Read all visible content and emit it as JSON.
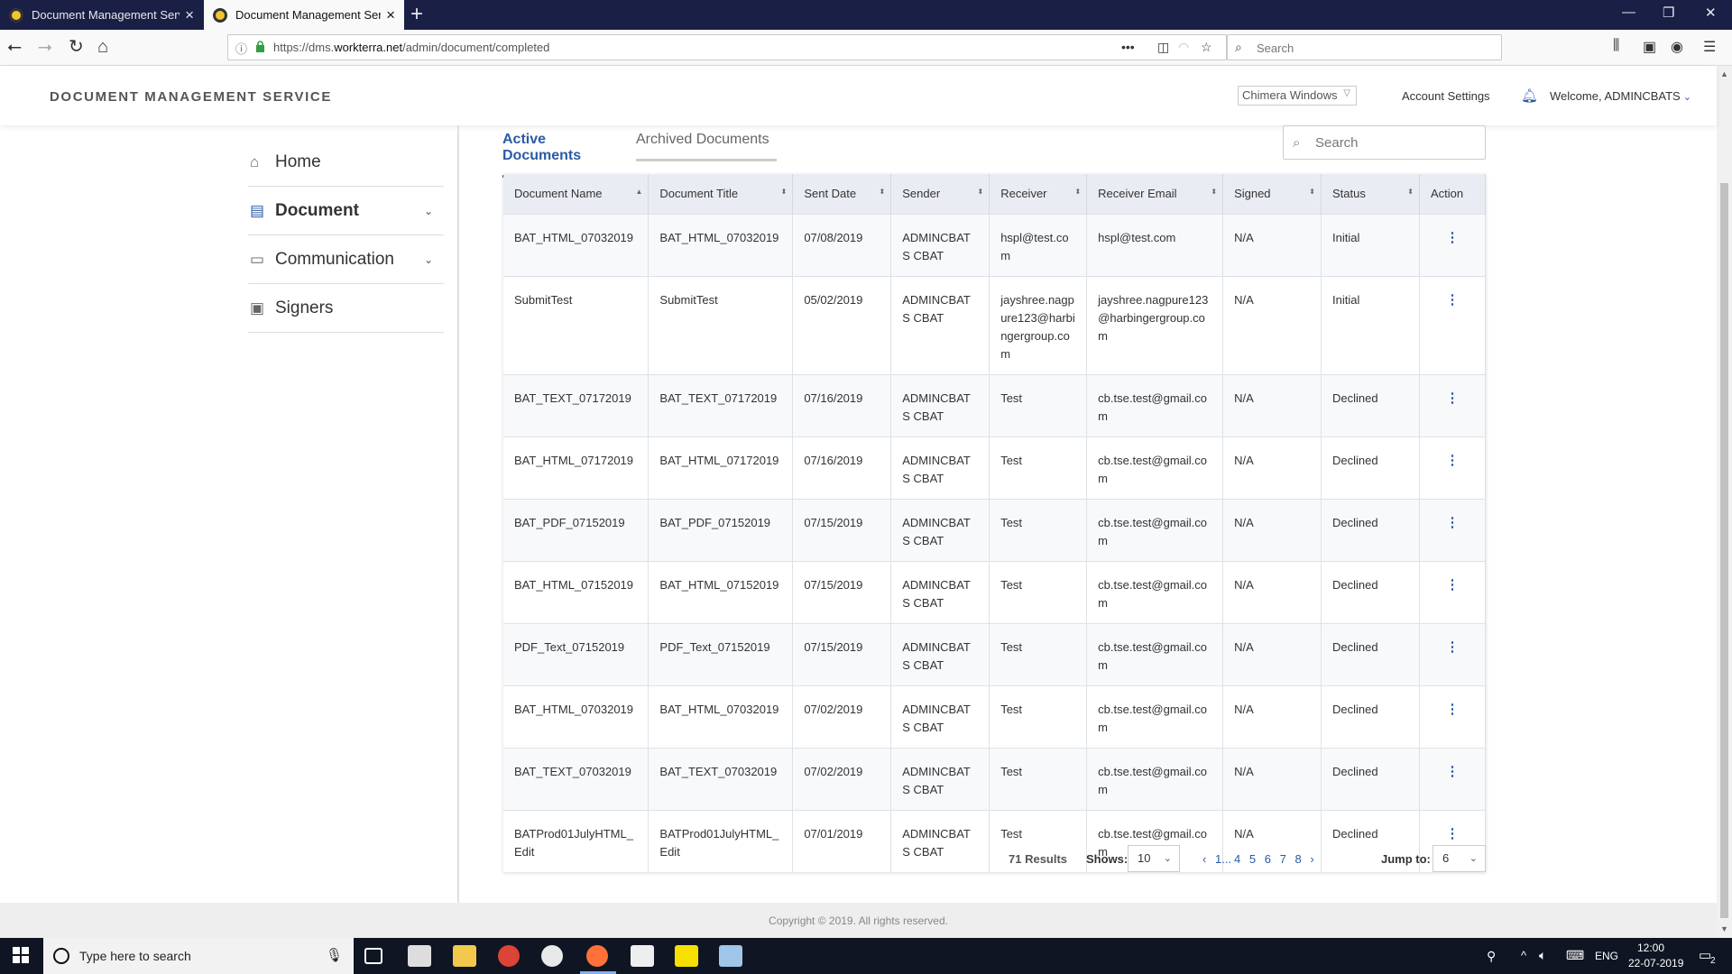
{
  "browser": {
    "tabs": [
      {
        "title": "Document Management Servic"
      },
      {
        "title": "Document Management Servic"
      }
    ],
    "url_prefix": "https://dms.",
    "url_domain": "workterra.net",
    "url_path": "/admin/document/completed",
    "search_placeholder": "Search"
  },
  "header": {
    "app_title": "DOCUMENT MANAGEMENT SERVICE",
    "company": "Chimera Windows",
    "account_settings": "Account Settings",
    "welcome": "Welcome, ADMINCBATS"
  },
  "sidebar": {
    "items": [
      {
        "label": "Home",
        "icon": "home-icon"
      },
      {
        "label": "Document",
        "icon": "document-icon"
      },
      {
        "label": "Communication",
        "icon": "chat-icon"
      },
      {
        "label": "Signers",
        "icon": "badge-icon"
      }
    ]
  },
  "tabs": {
    "active": "Active Documents",
    "archived": "Archived Documents"
  },
  "search": {
    "placeholder": "Search"
  },
  "table": {
    "columns": [
      "Document Name",
      "Document Title",
      "Sent Date",
      "Sender",
      "Receiver",
      "Receiver Email",
      "Signed",
      "Status",
      "Action"
    ],
    "rows": [
      [
        "BAT_HTML_07032019",
        "BAT_HTML_07032019",
        "07/08/2019",
        "ADMINCBATS CBAT",
        "hspl@test.com",
        "hspl@test.com",
        "N/A",
        "Initial"
      ],
      [
        "SubmitTest",
        "SubmitTest",
        "05/02/2019",
        "ADMINCBATS CBAT",
        "jayshree.nagpure123@harbingergroup.com",
        "jayshree.nagpure123@harbingergroup.com",
        "N/A",
        "Initial"
      ],
      [
        "BAT_TEXT_07172019",
        "BAT_TEXT_07172019",
        "07/16/2019",
        "ADMINCBATS CBAT",
        "Test",
        "cb.tse.test@gmail.com",
        "N/A",
        "Declined"
      ],
      [
        "BAT_HTML_07172019",
        "BAT_HTML_07172019",
        "07/16/2019",
        "ADMINCBATS CBAT",
        "Test",
        "cb.tse.test@gmail.com",
        "N/A",
        "Declined"
      ],
      [
        "BAT_PDF_07152019",
        "BAT_PDF_07152019",
        "07/15/2019",
        "ADMINCBATS CBAT",
        "Test",
        "cb.tse.test@gmail.com",
        "N/A",
        "Declined"
      ],
      [
        "BAT_HTML_07152019",
        "BAT_HTML_07152019",
        "07/15/2019",
        "ADMINCBATS CBAT",
        "Test",
        "cb.tse.test@gmail.com",
        "N/A",
        "Declined"
      ],
      [
        "PDF_Text_07152019",
        "PDF_Text_07152019",
        "07/15/2019",
        "ADMINCBATS CBAT",
        "Test",
        "cb.tse.test@gmail.com",
        "N/A",
        "Declined"
      ],
      [
        "BAT_HTML_07032019",
        "BAT_HTML_07032019",
        "07/02/2019",
        "ADMINCBATS CBAT",
        "Test",
        "cb.tse.test@gmail.com",
        "N/A",
        "Declined"
      ],
      [
        "BAT_TEXT_07032019",
        "BAT_TEXT_07032019",
        "07/02/2019",
        "ADMINCBATS CBAT",
        "Test",
        "cb.tse.test@gmail.com",
        "N/A",
        "Declined"
      ],
      [
        "BATProd01JulyHTML_Edit",
        "BATProd01JulyHTML_Edit",
        "07/01/2019",
        "ADMINCBATS CBAT",
        "Test",
        "cb.tse.test@gmail.com",
        "N/A",
        "Declined"
      ]
    ]
  },
  "pagination": {
    "results": "71 Results",
    "shows_label": "Shows:",
    "shows_value": "10",
    "pages": [
      "1",
      "...",
      "4",
      "5",
      "6",
      "7",
      "8"
    ],
    "jump_label": "Jump to:",
    "jump_value": "6"
  },
  "footer": {
    "copyright": "Copyright © 2019. All rights reserved."
  },
  "taskbar": {
    "search_placeholder": "Type here to search",
    "lang": "ENG",
    "time": "12:00",
    "date": "22-07-2019",
    "notifications": "2"
  },
  "colors": {
    "accent": "#2b5aa6",
    "tabbar": "#1a1f45",
    "taskbar": "#101523"
  }
}
